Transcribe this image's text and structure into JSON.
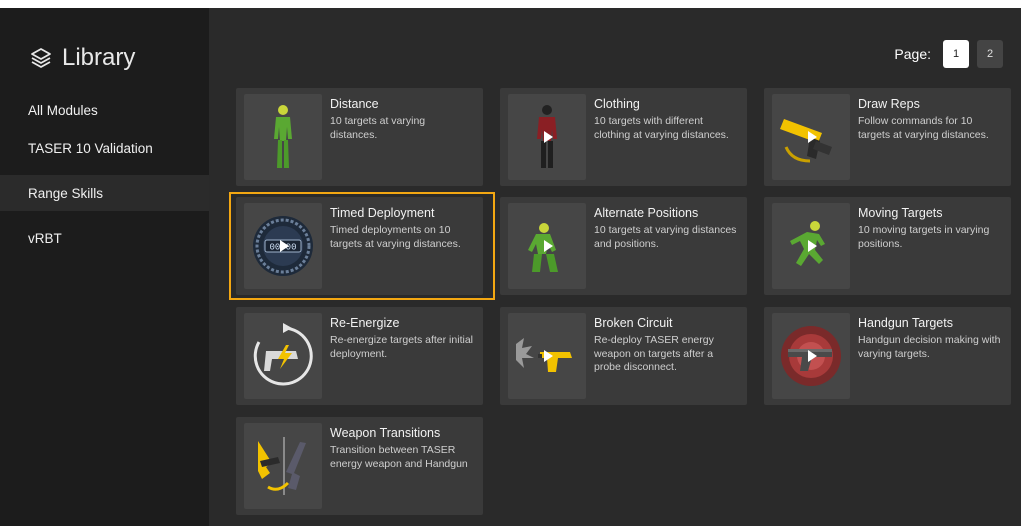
{
  "sidebar": {
    "title": "Library",
    "items": [
      {
        "label": "All Modules"
      },
      {
        "label": "TASER 10 Validation"
      },
      {
        "label": "Range Skills"
      },
      {
        "label": "vRBT"
      }
    ],
    "active_index": 2
  },
  "pagination": {
    "label": "Page:",
    "pages": [
      "1",
      "2"
    ],
    "current": "1"
  },
  "modules": [
    {
      "title": "Distance",
      "description": "10 targets at varying distances.",
      "thumbnail": "figure-standing-icon"
    },
    {
      "title": "Clothing",
      "description": "10 targets with different clothing at varying distances.",
      "thumbnail": "figure-clothed-icon"
    },
    {
      "title": "Draw Reps",
      "description": "Follow commands for 10 targets at varying distances.",
      "thumbnail": "taser-draw-icon"
    },
    {
      "title": "Timed Deployment",
      "description": "Timed deployments on 10 targets at varying distances.",
      "thumbnail": "timer-icon"
    },
    {
      "title": "Alternate Positions",
      "description": "10 targets at varying distances and positions.",
      "thumbnail": "figure-crouching-icon"
    },
    {
      "title": "Moving Targets",
      "description": "10 moving targets in varying positions.",
      "thumbnail": "figure-running-icon"
    },
    {
      "title": "Re-Energize",
      "description": "Re-energize targets after initial deployment.",
      "thumbnail": "re-energize-icon"
    },
    {
      "title": "Broken Circuit",
      "description": "Re-deploy TASER energy weapon on targets after a probe disconnect.",
      "thumbnail": "broken-circuit-icon"
    },
    {
      "title": "Handgun Targets",
      "description": "Handgun decision making with varying targets.",
      "thumbnail": "handgun-icon"
    },
    {
      "title": "Weapon Transitions",
      "description": "Transition between TASER energy weapon and Handgun",
      "thumbnail": "weapon-transition-icon"
    }
  ],
  "selected_module": "Timed Deployment",
  "colors": {
    "sidebar_bg": "#1c1c1c",
    "content_bg": "#2a2a2a",
    "card_bg": "#3a3a3a",
    "selection_outline": "#f3a712",
    "figure_green": "#5aa832",
    "taser_yellow": "#f2c200"
  }
}
